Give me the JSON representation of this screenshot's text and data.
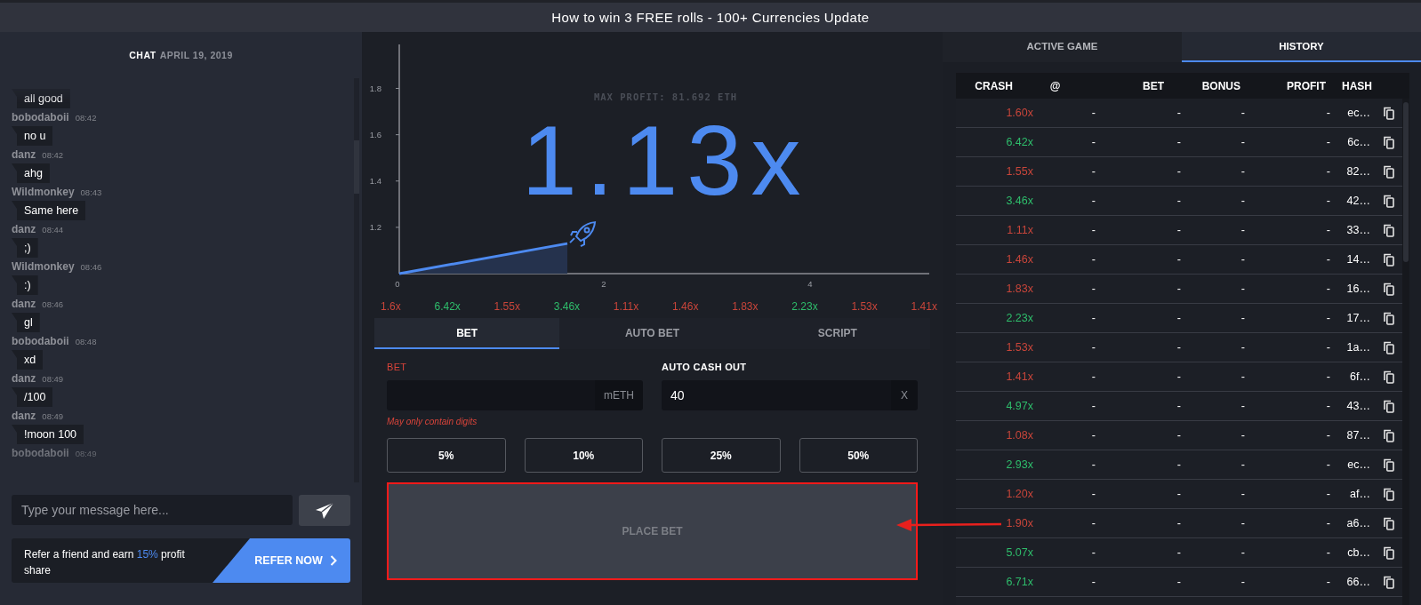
{
  "banner": "How to win 3 FREE rolls - 100+ Currencies Update",
  "chat": {
    "title": "CHAT",
    "date": "APRIL 19, 2019",
    "messages": [
      {
        "text": "all good"
      },
      {
        "user": "bobodaboii",
        "time": "08:42",
        "text": "no u"
      },
      {
        "user": "danz",
        "time": "08:42",
        "text": "ahg"
      },
      {
        "user": "Wildmonkey",
        "time": "08:43",
        "text": "Same here"
      },
      {
        "user": "danz",
        "time": "08:44",
        "text": ";)"
      },
      {
        "user": "Wildmonkey",
        "time": "08:46",
        "text": ":)"
      },
      {
        "user": "danz",
        "time": "08:46",
        "text": "gl"
      },
      {
        "user": "bobodaboii",
        "time": "08:48",
        "text": "xd"
      },
      {
        "user": "danz",
        "time": "08:49",
        "text": "/100"
      },
      {
        "user": "danz",
        "time": "08:49",
        "text": "!moon 100"
      },
      {
        "user": "bobodaboii",
        "time": "08:49"
      }
    ],
    "input": {
      "placeholder": "Type your message here..."
    },
    "referral": {
      "before": "Refer a friend and earn",
      "highlight": "15%",
      "after": "profit share",
      "button": "REFER NOW"
    }
  },
  "game": {
    "max_profit": "MAX PROFIT: 81.692 ETH",
    "multiplier": "1.13x",
    "chart_data": {
      "type": "area",
      "x": [
        0,
        1.63
      ],
      "series": [
        {
          "color": "#4d8af0",
          "values": [
            1.0,
            1.13
          ]
        }
      ],
      "xlim": [
        0,
        5.14
      ],
      "ylim": [
        1.0,
        1.99
      ],
      "xticks": [
        0,
        2,
        4
      ],
      "yticks": [
        1.2,
        1.4,
        1.6,
        1.8
      ]
    },
    "recent": [
      {
        "value": "1.6x",
        "color": "#c8453a"
      },
      {
        "value": "6.42x",
        "color": "#2ebd6b"
      },
      {
        "value": "1.55x",
        "color": "#c8453a"
      },
      {
        "value": "3.46x",
        "color": "#2ebd6b"
      },
      {
        "value": "1.11x",
        "color": "#c8453a"
      },
      {
        "value": "1.46x",
        "color": "#c8453a"
      },
      {
        "value": "1.83x",
        "color": "#c8453a"
      },
      {
        "value": "2.23x",
        "color": "#2ebd6b"
      },
      {
        "value": "1.53x",
        "color": "#c8453a"
      },
      {
        "value": "1.41x",
        "color": "#c8453a"
      }
    ]
  },
  "bet_panel": {
    "tabs": [
      {
        "label": "BET",
        "selected": true
      },
      {
        "label": "AUTO BET",
        "selected": false
      },
      {
        "label": "SCRIPT",
        "selected": false
      }
    ],
    "bet": {
      "label": "BET",
      "suffix": "mETH",
      "error": "May only contain digits"
    },
    "auto_cash_out": {
      "label": "AUTO CASH OUT",
      "value": "40",
      "suffix": "X"
    },
    "quick": [
      "5%",
      "10%",
      "25%",
      "50%"
    ],
    "place_bet": {
      "label": "PLACE BET",
      "disabled": true
    }
  },
  "history": {
    "tabs": [
      {
        "label": "ACTIVE GAME",
        "selected": false
      },
      {
        "label": "HISTORY",
        "selected": true
      }
    ],
    "columns": [
      "CRASH",
      "@",
      "BET",
      "BONUS",
      "PROFIT",
      "HASH"
    ],
    "rows": [
      {
        "crash": "1.60x",
        "color": "#c8453a",
        "at": "-",
        "bet": "-",
        "bonus": "-",
        "profit": "-",
        "hash": "ec…"
      },
      {
        "crash": "6.42x",
        "color": "#2ebd6b",
        "at": "-",
        "bet": "-",
        "bonus": "-",
        "profit": "-",
        "hash": "6c…"
      },
      {
        "crash": "1.55x",
        "color": "#c8453a",
        "at": "-",
        "bet": "-",
        "bonus": "-",
        "profit": "-",
        "hash": "82…"
      },
      {
        "crash": "3.46x",
        "color": "#2ebd6b",
        "at": "-",
        "bet": "-",
        "bonus": "-",
        "profit": "-",
        "hash": "42…"
      },
      {
        "crash": "1.11x",
        "color": "#c8453a",
        "at": "-",
        "bet": "-",
        "bonus": "-",
        "profit": "-",
        "hash": "33…"
      },
      {
        "crash": "1.46x",
        "color": "#c8453a",
        "at": "-",
        "bet": "-",
        "bonus": "-",
        "profit": "-",
        "hash": "14…"
      },
      {
        "crash": "1.83x",
        "color": "#c8453a",
        "at": "-",
        "bet": "-",
        "bonus": "-",
        "profit": "-",
        "hash": "16…"
      },
      {
        "crash": "2.23x",
        "color": "#2ebd6b",
        "at": "-",
        "bet": "-",
        "bonus": "-",
        "profit": "-",
        "hash": "17…"
      },
      {
        "crash": "1.53x",
        "color": "#c8453a",
        "at": "-",
        "bet": "-",
        "bonus": "-",
        "profit": "-",
        "hash": "1a…"
      },
      {
        "crash": "1.41x",
        "color": "#c8453a",
        "at": "-",
        "bet": "-",
        "bonus": "-",
        "profit": "-",
        "hash": "6f…"
      },
      {
        "crash": "4.97x",
        "color": "#2ebd6b",
        "at": "-",
        "bet": "-",
        "bonus": "-",
        "profit": "-",
        "hash": "43…"
      },
      {
        "crash": "1.08x",
        "color": "#c8453a",
        "at": "-",
        "bet": "-",
        "bonus": "-",
        "profit": "-",
        "hash": "87…"
      },
      {
        "crash": "2.93x",
        "color": "#2ebd6b",
        "at": "-",
        "bet": "-",
        "bonus": "-",
        "profit": "-",
        "hash": "ec…"
      },
      {
        "crash": "1.20x",
        "color": "#c8453a",
        "at": "-",
        "bet": "-",
        "bonus": "-",
        "profit": "-",
        "hash": "af…"
      },
      {
        "crash": "1.90x",
        "color": "#c8453a",
        "at": "-",
        "bet": "-",
        "bonus": "-",
        "profit": "-",
        "hash": "a6…"
      },
      {
        "crash": "5.07x",
        "color": "#2ebd6b",
        "at": "-",
        "bet": "-",
        "bonus": "-",
        "profit": "-",
        "hash": "cb…"
      },
      {
        "crash": "6.71x",
        "color": "#2ebd6b",
        "at": "-",
        "bet": "-",
        "bonus": "-",
        "profit": "-",
        "hash": "66…"
      }
    ]
  }
}
